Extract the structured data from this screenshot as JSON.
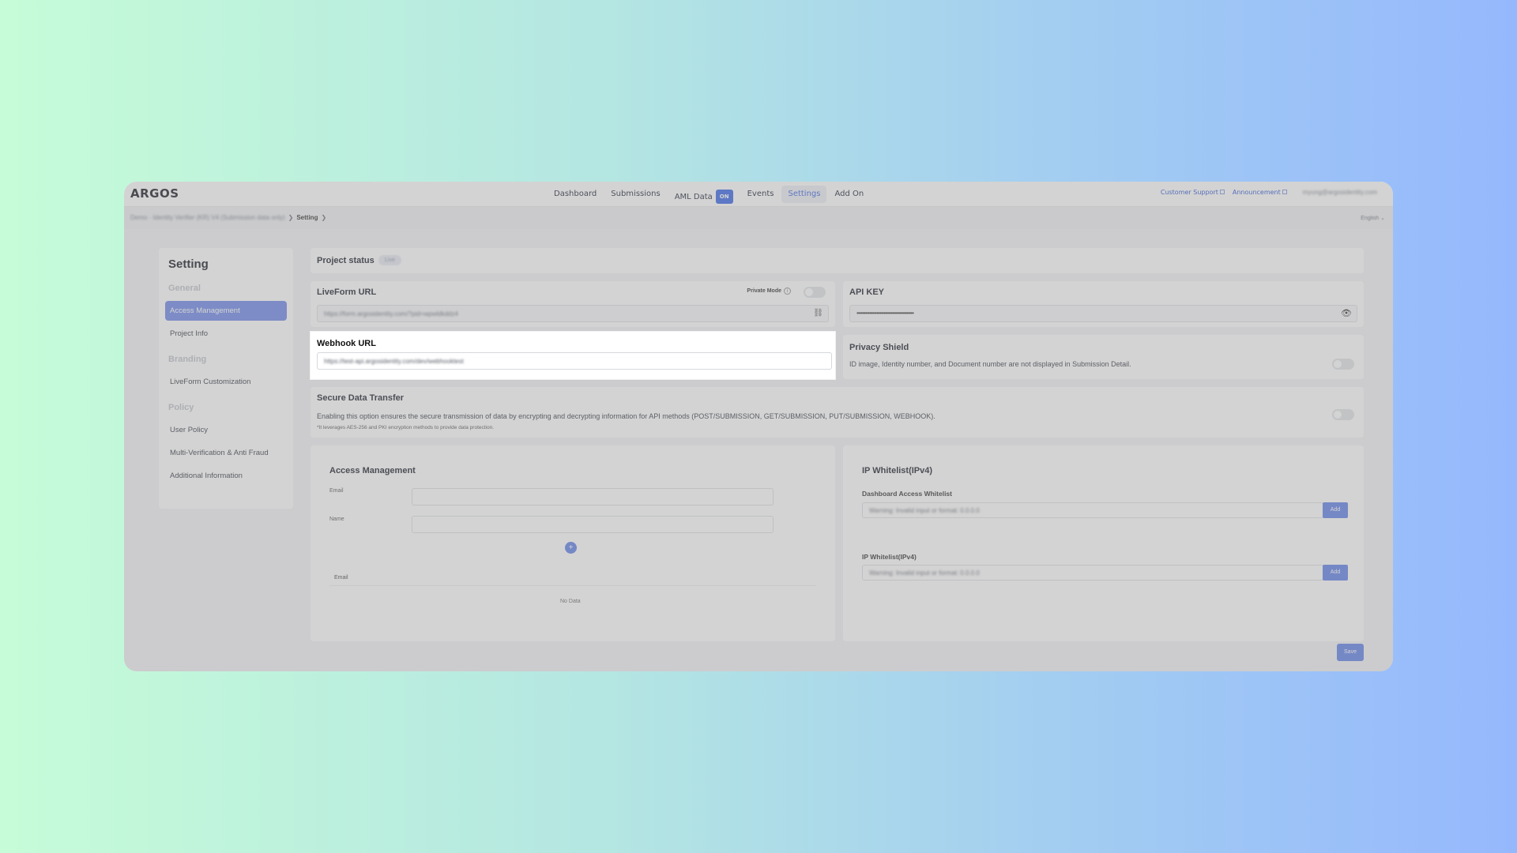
{
  "app": {
    "logo": "ARGOS"
  },
  "nav": {
    "items": [
      {
        "label": "Dashboard",
        "active": false
      },
      {
        "label": "Submissions",
        "active": false
      },
      {
        "label": "AML Data",
        "active": false,
        "badge": "ON"
      },
      {
        "label": "Events",
        "active": false
      },
      {
        "label": "Settings",
        "active": true
      },
      {
        "label": "Add On",
        "active": false
      }
    ],
    "right_links": [
      {
        "label": "Customer Support"
      },
      {
        "label": "Announcement"
      }
    ],
    "user_email": "myung@argosidentity.com"
  },
  "breadcrumb": {
    "project": "Demo · Identity Verifier (KR) V4 (Submission data only)",
    "current": "Setting",
    "language": "English"
  },
  "sidebar": {
    "title": "Setting",
    "sections": [
      {
        "heading": "General",
        "items": [
          {
            "label": "Access Management",
            "active": true
          },
          {
            "label": "Project Info",
            "active": false
          }
        ]
      },
      {
        "heading": "Branding",
        "items": [
          {
            "label": "LiveForm Customization",
            "active": false
          }
        ]
      },
      {
        "heading": "Policy",
        "items": [
          {
            "label": "User Policy",
            "active": false
          },
          {
            "label": "Multi-Verification & Anti Fraud",
            "active": false
          },
          {
            "label": "Additional Information",
            "active": false
          }
        ]
      }
    ]
  },
  "project_status": {
    "label": "Project status",
    "badge": "Live"
  },
  "liveform": {
    "title": "LiveForm URL",
    "private_mode_label": "Private Mode",
    "url": "https://form.argosidentity.com/?pid=wpwldkddz4"
  },
  "api_key": {
    "title": "API KEY",
    "masked": "••••••••••••••••••••••••••••••••••••••••"
  },
  "webhook": {
    "title": "Webhook URL",
    "url": "https://test-api.argosidentity.com/dev/webhooktest"
  },
  "privacy_shield": {
    "title": "Privacy Shield",
    "description": "ID image, Identity number, and Document number are not displayed in Submission Detail."
  },
  "secure_transfer": {
    "title": "Secure Data Transfer",
    "description": "Enabling this option ensures the secure transmission of data by encrypting and decrypting information for API methods (POST/SUBMISSION, GET/SUBMISSION, PUT/SUBMISSION, WEBHOOK).",
    "note": "*It leverages AES-256 and PKI encryption methods to provide data protection."
  },
  "access_management": {
    "title": "Access Management",
    "email_label": "Email",
    "name_label": "Name",
    "table_header_email": "Email",
    "empty_text": "No Data"
  },
  "ip_whitelist": {
    "title": "IP Whitelist(IPv4)",
    "dashboard_label": "Dashboard Access Whitelist",
    "dashboard_placeholder": "Warning: Invalid input or format: 0.0.0.0",
    "ip_label": "IP Whitelist(IPv4)",
    "ip_placeholder": "Warning: Invalid input or format: 0.0.0.0",
    "add_label": "Add"
  },
  "save_label": "Save"
}
